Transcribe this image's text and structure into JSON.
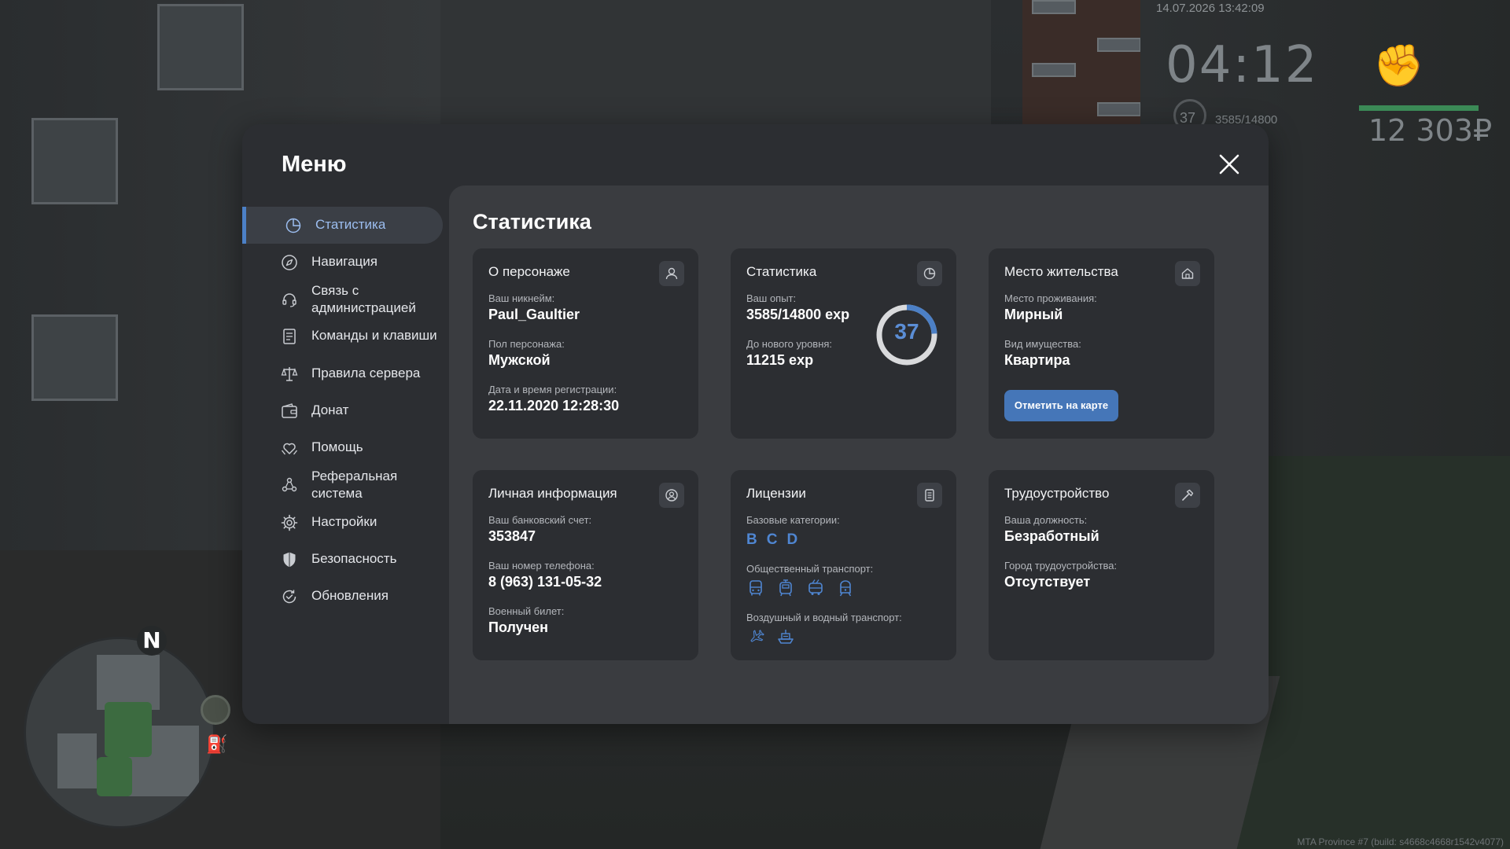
{
  "hud": {
    "date": "14.07.2026 13:42:09",
    "time": "04:12",
    "level": "37",
    "exp": "3585/14800",
    "money": "12 303₽",
    "bar_fraction": 1.0,
    "build": "MTA Province #7 (build: s4668c4668r1542v4077)"
  },
  "minimap": {
    "compass": "N"
  },
  "menu": {
    "title": "Меню",
    "nav": [
      {
        "label": "Статистика",
        "icon": "pie-chart-icon",
        "active": true
      },
      {
        "label": "Навигация",
        "icon": "compass-icon",
        "active": false
      },
      {
        "label": "Связь с администрацией",
        "icon": "headset-icon",
        "active": false
      },
      {
        "label": "Команды и клавиши",
        "icon": "document-list-icon",
        "active": false
      },
      {
        "label": "Правила сервера",
        "icon": "scales-icon",
        "active": false
      },
      {
        "label": "Донат",
        "icon": "wallet-icon",
        "active": false
      },
      {
        "label": "Помощь",
        "icon": "heart-hands-icon",
        "active": false
      },
      {
        "label": "Реферальная система",
        "icon": "people-network-icon",
        "active": false
      },
      {
        "label": "Настройки",
        "icon": "gear-icon",
        "active": false
      },
      {
        "label": "Безопасность",
        "icon": "shield-icon",
        "active": false
      },
      {
        "label": "Обновления",
        "icon": "refresh-check-icon",
        "active": false
      }
    ]
  },
  "stats": {
    "title": "Статистика",
    "character": {
      "title": "О персонаже",
      "nick_label": "Ваш никнейм:",
      "nick": "Paul_Gaultier",
      "gender_label": "Пол персонажа:",
      "gender": "Мужской",
      "reg_label": "Дата и время регистрации:",
      "reg": "22.11.2020 12:28:30"
    },
    "statistics": {
      "title": "Статистика",
      "exp_label": "Ваш опыт:",
      "exp": "3585/14800 exp",
      "next_label": "До нового уровня:",
      "next": "11215 exp",
      "level": "37",
      "progress": 0.2422
    },
    "residence": {
      "title": "Место жительства",
      "place_label": "Место проживания:",
      "place": "Мирный",
      "type_label": "Вид имущества:",
      "type": "Квартира",
      "button": "Отметить на карте"
    },
    "personal": {
      "title": "Личная информация",
      "bank_label": "Ваш банковский счет:",
      "bank": "353847",
      "phone_label": "Ваш номер телефона:",
      "phone": "8 (963) 131-05-32",
      "military_label": "Военный билет:",
      "military": "Получен"
    },
    "licenses": {
      "title": "Лицензии",
      "base_label": "Базовые категории:",
      "base": [
        "B",
        "C",
        "D"
      ],
      "public_label": "Общественный транспорт:",
      "public_icons": [
        "bus-icon",
        "tram-icon",
        "trolleybus-icon",
        "train-icon"
      ],
      "air_label": "Воздушный и водный транспорт:",
      "air_icons": [
        "plane-icon",
        "boat-icon"
      ]
    },
    "employment": {
      "title": "Трудоустройство",
      "position_label": "Ваша должность:",
      "position": "Безработный",
      "city_label": "Город трудоустройства:",
      "city": "Отсутствует"
    }
  },
  "colors": {
    "accent": "#4c80c6",
    "accent_text": "#5b8ed6",
    "panel": "#2c2e32",
    "content": "#3a3c40",
    "button": "#4576b8"
  }
}
